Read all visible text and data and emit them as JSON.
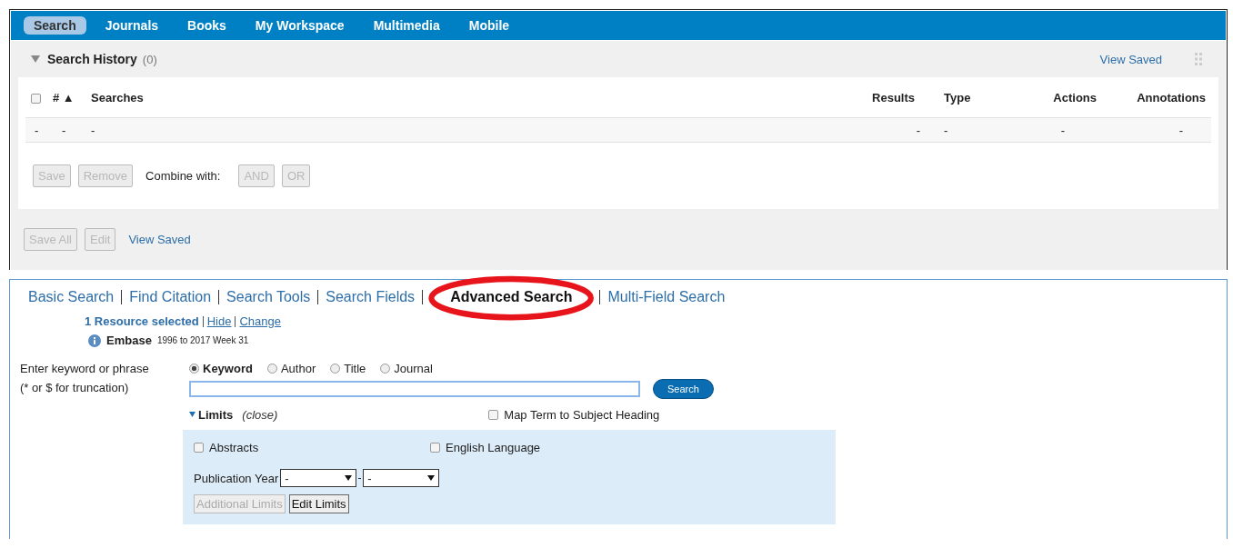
{
  "nav_tabs": [
    {
      "label": "Search",
      "selected": true
    },
    {
      "label": "Journals",
      "selected": false
    },
    {
      "label": "Books",
      "selected": false
    },
    {
      "label": "My Workspace",
      "selected": false
    },
    {
      "label": "Multimedia",
      "selected": false
    },
    {
      "label": "Mobile",
      "selected": false
    }
  ],
  "search_history": {
    "title": "Search History",
    "count": "(0)",
    "expanded": true,
    "view_saved": "View Saved",
    "select_all_checked": false,
    "sort_mark": "▲",
    "columns": [
      "",
      "#",
      "Searches",
      "Results",
      "Type",
      "Actions",
      "Annotations"
    ],
    "rows": [
      {
        "checked": null,
        "cells": [
          "-",
          "-",
          "-",
          "-",
          "-",
          "-",
          "-"
        ]
      }
    ],
    "row_buttons": [
      {
        "label": "Save",
        "disabled": true
      },
      {
        "label": "Remove",
        "disabled": true
      }
    ],
    "combine_label": "Combine with:",
    "combine_buttons": [
      {
        "label": "AND",
        "disabled": true
      },
      {
        "label": "OR",
        "disabled": true
      }
    ],
    "footer_buttons": [
      {
        "label": "Save All",
        "disabled": true
      },
      {
        "label": "Edit",
        "disabled": true
      }
    ],
    "footer_link": "View Saved"
  },
  "search_modes": [
    {
      "label": "Basic Search",
      "selected": false
    },
    {
      "label": "Find Citation",
      "selected": false
    },
    {
      "label": "Search Tools",
      "selected": false
    },
    {
      "label": "Search Fields",
      "selected": false
    },
    {
      "label": "Advanced Search",
      "selected": true
    },
    {
      "label": "Multi-Field Search",
      "selected": false
    }
  ],
  "annotation": {
    "kind": "ellipse",
    "color": "#e8141b"
  },
  "resources": {
    "selected": "1 Resource selected",
    "hide": "Hide",
    "change": "Change",
    "database": "Embase",
    "range": "1996 to 2017 Week 31"
  },
  "query": {
    "prompt": "Enter keyword or phrase",
    "hint": "(* or $ for truncation)",
    "fields": [
      {
        "label": "Keyword",
        "selected": true
      },
      {
        "label": "Author",
        "selected": false
      },
      {
        "label": "Title",
        "selected": false
      },
      {
        "label": "Journal",
        "selected": false
      }
    ],
    "button": "Search"
  },
  "limits": {
    "label": "Limits",
    "toggle": "(close)",
    "expanded": true,
    "map_term": {
      "label": "Map Term to Subject Heading",
      "checked": false
    },
    "checkboxes": [
      {
        "label": "Abstracts",
        "checked": false
      },
      {
        "label": "English Language",
        "checked": false
      }
    ],
    "year_label": "Publication Year",
    "year_from": "-",
    "year_to": "-",
    "buttons": [
      {
        "label": "Additional Limits",
        "disabled": true
      },
      {
        "label": "Edit Limits",
        "disabled": false
      }
    ]
  }
}
